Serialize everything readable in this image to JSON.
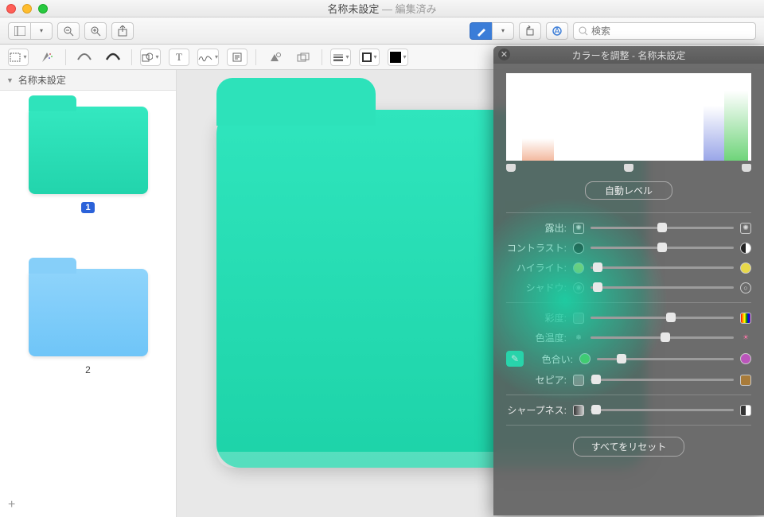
{
  "window": {
    "title_main": "名称未設定",
    "title_sep": " — ",
    "title_sub": "編集済み"
  },
  "toolbar": {
    "search_placeholder": "検索"
  },
  "sidebar": {
    "header": "名称未設定",
    "thumbs": [
      {
        "label": "1",
        "color": "teal",
        "selected": true
      },
      {
        "label": "2",
        "color": "blue",
        "selected": false
      }
    ]
  },
  "panel": {
    "title": "カラーを調整 - 名称未設定",
    "auto_levels": "自動レベル",
    "reset_all": "すべてをリセット",
    "sliders": {
      "exposure": {
        "label": "露出:",
        "pos": 50
      },
      "contrast": {
        "label": "コントラスト:",
        "pos": 50
      },
      "highlights": {
        "label": "ハイライト:",
        "pos": 5
      },
      "shadows": {
        "label": "シャドウ:",
        "pos": 5
      },
      "saturation": {
        "label": "彩度:",
        "pos": 56
      },
      "temperature": {
        "label": "色温度:",
        "pos": 52
      },
      "tint": {
        "label": "色合い:",
        "pos": 18
      },
      "sepia": {
        "label": "セピア:",
        "pos": 4
      },
      "sharpness": {
        "label": "シャープネス:",
        "pos": 4
      }
    }
  }
}
